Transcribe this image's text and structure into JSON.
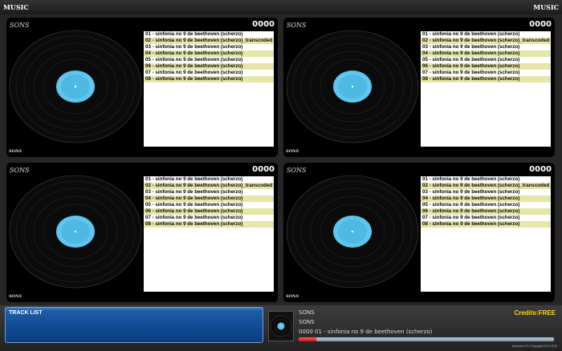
{
  "header": {
    "title_left": "MUSIC",
    "title_right": "MUSIC"
  },
  "panels": [
    {
      "label": "SONS",
      "counter": "0000",
      "footer": "SONS",
      "tracks": [
        "01 - sinfonia no 9 de beethoven (scherzo)",
        "02 - sinfonia no 9 de beethoven (scherzo)_transcoded",
        "03 - sinfonia no 9 de beethoven (scherzo)",
        "04 - sinfonia no 9 de beethoven (scherzo)",
        "05 - sinfonia no 9 de beethoven (scherzo)",
        "06 - sinfonia no 9 de beethoven (scherzo)",
        "07 - sinfonia no 9 de beethoven (scherzo)",
        "08 - sinfonia no 9 de beethoven (scherzo)"
      ]
    },
    {
      "label": "SONS",
      "counter": "0000",
      "footer": "SONS",
      "tracks": [
        "01 - sinfonia no 9 de beethoven (scherzo)",
        "02 - sinfonia no 9 de beethoven (scherzo)_transcoded",
        "03 - sinfonia no 9 de beethoven (scherzo)",
        "04 - sinfonia no 9 de beethoven (scherzo)",
        "05 - sinfonia no 9 de beethoven (scherzo)",
        "06 - sinfonia no 9 de beethoven (scherzo)",
        "07 - sinfonia no 9 de beethoven (scherzo)",
        "08 - sinfonia no 9 de beethoven (scherzo)"
      ]
    },
    {
      "label": "SONS",
      "counter": "0000",
      "footer": "SONS",
      "tracks": [
        "01 - sinfonia no 9 de beethoven (scherzo)",
        "02 - sinfonia no 9 de beethoven (scherzo)_transcoded",
        "03 - sinfonia no 9 de beethoven (scherzo)",
        "04 - sinfonia no 9 de beethoven (scherzo)",
        "05 - sinfonia no 9 de beethoven (scherzo)",
        "06 - sinfonia no 9 de beethoven (scherzo)",
        "07 - sinfonia no 9 de beethoven (scherzo)",
        "08 - sinfonia no 9 de beethoven (scherzo)"
      ]
    },
    {
      "label": "SONS",
      "counter": "0000",
      "footer": "SONS",
      "tracks": [
        "01 - sinfonia no 9 de beethoven (scherzo)",
        "02 - sinfonia no 9 de beethoven (scherzo)_transcoded",
        "03 - sinfonia no 9 de beethoven (scherzo)",
        "04 - sinfonia no 9 de beethoven (scherzo)",
        "05 - sinfonia no 9 de beethoven (scherzo)",
        "06 - sinfonia no 9 de beethoven (scherzo)",
        "07 - sinfonia no 9 de beethoven (scherzo)",
        "08 - sinfonia no 9 de beethoven (scherzo)"
      ]
    }
  ],
  "footer": {
    "tracklist_label": "TRACK LIST",
    "now_playing_line1": "SONS",
    "now_playing_line2": "SONS",
    "now_playing_line3": "0000 01 - sinfonia no 9 de beethoven (scherzo)",
    "credits": "Credits:FREE",
    "progress_fraction": 0.07,
    "copyright": "Musicbox V1.0 Copyright 2011-2013"
  },
  "colors": {
    "background": "#262626",
    "track_highlight": "#e6e6a8",
    "label_blue": "#5fc6ef",
    "credits_yellow": "#ffd800",
    "progress_red": "#d01010",
    "tracklist_button": "#0f4a93"
  }
}
